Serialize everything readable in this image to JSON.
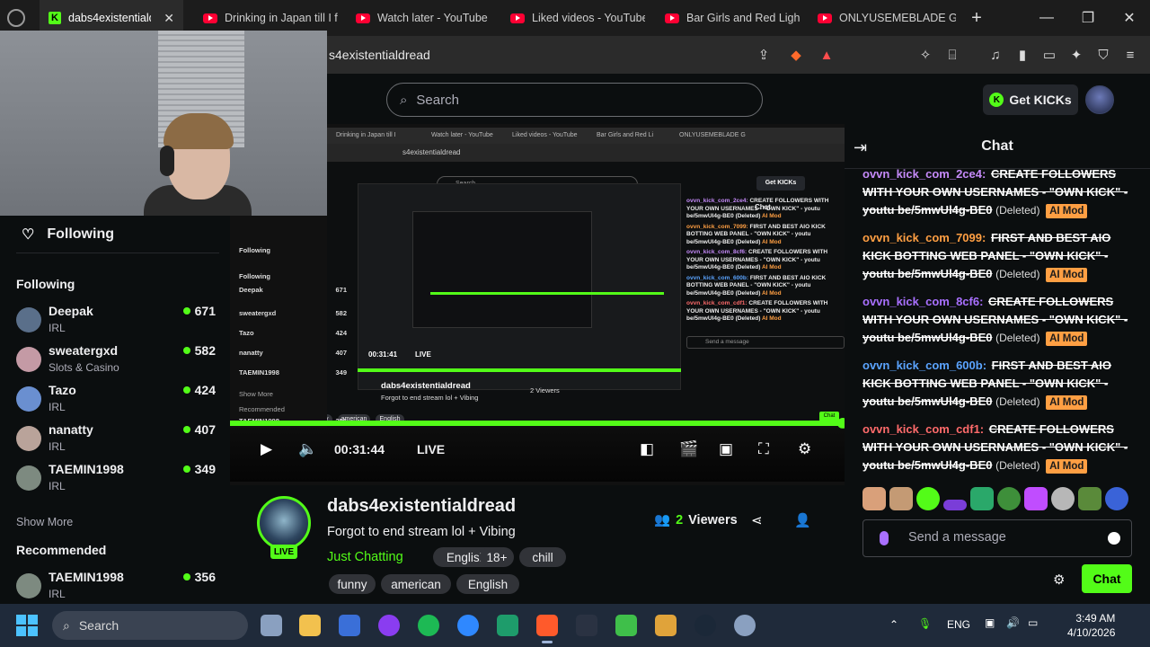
{
  "browser": {
    "tabs": [
      {
        "label": "dabs4existentialdr",
        "active": true,
        "favicon": "kick-icon"
      },
      {
        "label": "Drinking in Japan till I f",
        "favicon": "youtube-icon"
      },
      {
        "label": "Watch later - YouTube",
        "favicon": "youtube-icon"
      },
      {
        "label": "Liked videos - YouTube",
        "favicon": "youtube-icon"
      },
      {
        "label": "Bar Girls and Red Light",
        "favicon": "youtube-icon"
      },
      {
        "label": "ONLYUSEMEBLADE GE",
        "favicon": "youtube-icon"
      }
    ],
    "url": "s4existentialdread"
  },
  "kick": {
    "search_placeholder": "Search",
    "get_kicks": "Get KICKs",
    "sidebar": {
      "following_button": "Following",
      "following_title": "Following",
      "channels": [
        {
          "name": "Deepak",
          "category": "IRL",
          "viewers": "671",
          "color": "#5a6f8a"
        },
        {
          "name": "sweatergxd",
          "category": "Slots & Casino",
          "viewers": "582",
          "color": "#c49aa5"
        },
        {
          "name": "Tazo",
          "category": "IRL",
          "viewers": "424",
          "color": "#6a8fd0"
        },
        {
          "name": "nanatty",
          "category": "IRL",
          "viewers": "407",
          "color": "#b9a39a"
        },
        {
          "name": "TAEMIN1998",
          "category": "IRL",
          "viewers": "349",
          "color": "#7d8a80"
        }
      ],
      "show_more": "Show More",
      "recommended_title": "Recommended",
      "recommended": [
        {
          "name": "TAEMIN1998",
          "category": "IRL",
          "viewers": "356",
          "color": "#7d8a80"
        }
      ]
    },
    "player": {
      "time": "00:31:44",
      "live": "LIVE"
    },
    "stream": {
      "name": "dabs4existentialdread",
      "title": "Forgot to end stream lol + Vibing",
      "category": "Just Chatting",
      "live_badge": "LIVE",
      "viewers_count": "2",
      "viewers_label": "Viewers",
      "tags_row1": [
        "English",
        "18+",
        "chill"
      ],
      "tags_row2": [
        "funny",
        "american",
        "English"
      ]
    },
    "chat": {
      "title": "Chat",
      "messages": [
        {
          "user": "ovvn_kick_com_2ce4:",
          "user_color": "#c58af9",
          "text": "CREATE FOLLOWERS WITH YOUR OWN USERNAMES - \"OWN KICK\" - youtu be/5mwUl4g-BE0",
          "deleted": "(Deleted)",
          "badge": "AI Mod"
        },
        {
          "user": "ovvn_kick_com_7099:",
          "user_color": "#ff9f43",
          "text": "FIRST AND BEST AIO KICK BOTTING WEB PANEL - \"OWN KICK\" - youtu be/5mwUl4g-BE0",
          "deleted": "(Deleted)",
          "badge": "AI Mod"
        },
        {
          "user": "ovvn_kick_com_8cf6:",
          "user_color": "#a970ff",
          "text": "CREATE FOLLOWERS WITH YOUR OWN USERNAMES - \"OWN KICK\" - youtu be/5mwUl4g-BE0",
          "deleted": "(Deleted)",
          "badge": "AI Mod"
        },
        {
          "user": "ovvn_kick_com_600b:",
          "user_color": "#5ba4ff",
          "text": "FIRST AND BEST AIO KICK BOTTING WEB PANEL - \"OWN KICK\" - youtu be/5mwUl4g-BE0",
          "deleted": "(Deleted)",
          "badge": "AI Mod"
        },
        {
          "user": "ovvn_kick_com_cdf1:",
          "user_color": "#ff6b6b",
          "text": "CREATE FOLLOWERS WITH YOUR OWN USERNAMES - \"OWN KICK\" - youtu be/5mwUl4g-BE0",
          "deleted": "(Deleted)",
          "badge": "AI Mod"
        }
      ],
      "input_placeholder": "Send a message",
      "send_label": "Chat"
    }
  },
  "nested": {
    "tabs": [
      "Drinking in Japan till I",
      "Watch later - YouTube",
      "Liked videos - YouTube",
      "Bar Girls and Red Li",
      "ONLYUSEMEBLADE G"
    ],
    "url": "s4existentialdread",
    "search": "Search",
    "get_kicks": "Get KICKs",
    "chat_title": "Chat",
    "following": "Following",
    "channels": [
      "Deepak",
      "sweatergxd",
      "Tazo",
      "nanatty",
      "TAEMIN1998"
    ],
    "viewers": [
      "671",
      "582",
      "424",
      "407",
      "349"
    ],
    "show_more": "Show More",
    "recommended": "Recommended",
    "rec_channel": "TAEMIN1998",
    "rec_viewers": "356",
    "stream_name": "dabs4existentialdread",
    "stream_title": "Forgot to end stream lol + Vibing",
    "viewers_text": "2 Viewers",
    "time": "00:31:41",
    "live": "LIVE",
    "tags": [
      "funny",
      "american",
      "English"
    ],
    "send_placeholder": "Send a message",
    "chat_btn": "Chat",
    "chat_lines": [
      {
        "user": "ovvn_kick_com_2ce4:",
        "text": "CREATE FOLLOWERS WITH YOUR OWN USERNAMES - \"OWN KICK\" - youtu be/5mwUl4g-BE0"
      },
      {
        "user": "ovvn_kick_com_7099:",
        "text": "FIRST AND BEST AIO KICK BOTTING WEB PANEL - \"OWN KICK\" - youtu be/5mwUl4g-BE0"
      },
      {
        "user": "ovvn_kick_com_8cf6:",
        "text": "CREATE FOLLOWERS WITH YOUR OWN USERNAMES - \"OWN KICK\" - youtu be/5mwUl4g-BE0"
      },
      {
        "user": "ovvn_kick_com_600b:",
        "text": "FIRST AND BEST AIO KICK BOTTING WEB PANEL - \"OWN KICK\" - youtu be/5mwUl4g-BE0"
      },
      {
        "user": "ovvn_kick_com_cdf1:",
        "text": "CREATE FOLLOWERS WITH YOUR OWN USERNAMES - \"OWN KICK\" - youtu be/5mwUl4g-BE0"
      }
    ],
    "deleted": "(Deleted)",
    "badge": "AI Mod"
  },
  "taskbar": {
    "search": "Search",
    "lang": "ENG",
    "time": "3:49 AM",
    "date": "4/10/2026"
  },
  "colors": {
    "kick_green": "#53fc18",
    "ai_mod": "#ff9f43",
    "background": "#0b0e0f"
  }
}
